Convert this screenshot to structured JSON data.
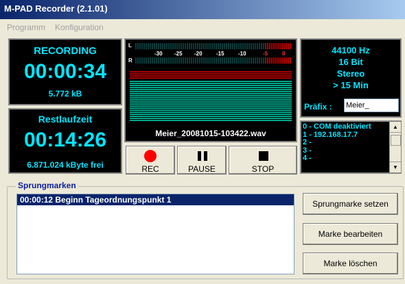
{
  "window": {
    "title": "M-PAD Recorder (2.1.01)"
  },
  "menu": [
    "Programm",
    "Konfiguration"
  ],
  "recording": {
    "label": "RECORDING",
    "time": "00:00:34",
    "size": "5.772 kB"
  },
  "remaining": {
    "label": "Restlaufzeit",
    "time": "00:14:26",
    "free": "6.871.024 kByte frei"
  },
  "vu": {
    "channel_left": "L",
    "channel_right": "R",
    "scale": [
      "-30",
      "-25",
      "-20",
      "-15",
      "-10",
      "-5",
      "0"
    ],
    "filename": "Meier_20081015-103422.wav"
  },
  "controls": {
    "rec": "REC",
    "pause": "PAUSE",
    "stop": "STOP"
  },
  "format": {
    "rate": "44100 Hz",
    "bits": "16 Bit",
    "mode": "Stereo",
    "duration": "> 15 Min",
    "prefix_label": "Präfix :",
    "prefix_value": "Meier_"
  },
  "com_list": [
    "0 - COM deaktiviert",
    "1 - 192.168.17.7",
    "2 -",
    "3 -",
    "4 -"
  ],
  "markers": {
    "group_title": "Sprungmarken",
    "items": [
      "00:00:12  Beginn Tageordnungspunkt 1"
    ],
    "set_button": "Sprungmarke setzen",
    "edit_button": "Marke bearbeiten",
    "delete_button": "Marke löschen"
  },
  "colors": {
    "display_text": "#00e5ff",
    "vu_bars": "#00a88a",
    "vu_red": "#b00000",
    "rec_dot": "#ff0000",
    "title_bar": "#0a246a",
    "group_title": "#0a1e9f"
  }
}
